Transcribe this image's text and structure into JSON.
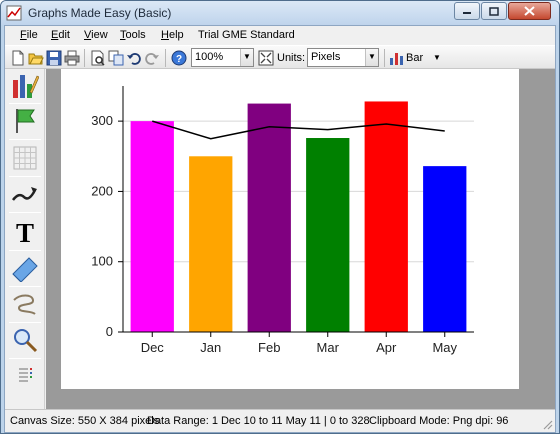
{
  "window": {
    "title": "Graphs Made Easy (Basic)",
    "controls": {
      "minimize": "minimize",
      "maximize": "maximize",
      "close": "close"
    }
  },
  "menu": {
    "items": [
      {
        "label": "File",
        "accel": "F",
        "rest": "ile"
      },
      {
        "label": "Edit",
        "accel": "E",
        "rest": "dit"
      },
      {
        "label": "View",
        "accel": "V",
        "rest": "iew"
      },
      {
        "label": "Tools",
        "accel": "T",
        "rest": "ools"
      },
      {
        "label": "Help",
        "accel": "H",
        "rest": "elp"
      }
    ],
    "trial": "Trial GME Standard"
  },
  "toolbar": {
    "zoom": "100%",
    "units_label": "Units:",
    "units": "Pixels",
    "chart_type": "Bar"
  },
  "chart_data": {
    "type": "bar",
    "categories": [
      "Dec",
      "Jan",
      "Feb",
      "Mar",
      "Apr",
      "May"
    ],
    "values": [
      300,
      250,
      325,
      276,
      328,
      236
    ],
    "colors": [
      "#ff00ff",
      "#ffa500",
      "#800080",
      "#008000",
      "#ff0000",
      "#0000ff"
    ],
    "line_overlay": [
      300,
      275,
      292,
      288,
      296,
      286
    ],
    "yticks": [
      0,
      100,
      200,
      300
    ],
    "ylim": [
      0,
      350
    ],
    "grid": true
  },
  "status": {
    "canvas_size": "Canvas Size:  550 X 384  pixels",
    "data_range": "Data Range:  1 Dec 10 to 11 May 11  |  0 to 328",
    "clipboard": "Clipboard Mode: Png  dpi: 96"
  }
}
